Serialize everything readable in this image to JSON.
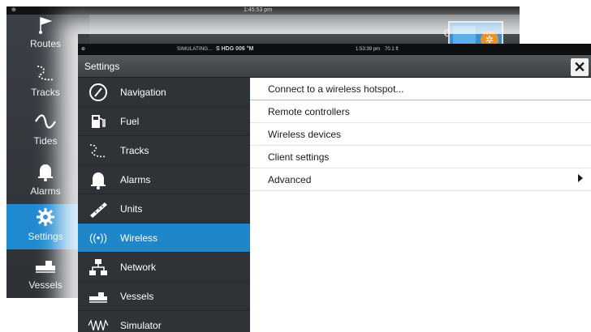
{
  "background_screen": {
    "status_time": "1:45:53 pm",
    "close_label": "Close",
    "sidebar": [
      {
        "label": "Routes",
        "icon": "route-flag-icon"
      },
      {
        "label": "Tracks",
        "icon": "track-icon"
      },
      {
        "label": "Tides",
        "icon": "wave-icon"
      },
      {
        "label": "Alarms",
        "icon": "bell-icon"
      },
      {
        "label": "Settings",
        "icon": "gear-icon",
        "selected": true
      },
      {
        "label": "Vessels",
        "icon": "vessel-icon"
      }
    ]
  },
  "dialog": {
    "status": {
      "simulating": "SIMULATING...",
      "heading": "S HDG 006 °M",
      "time": "1:53:39 pm",
      "depth": "70.1 ft"
    },
    "title": "Settings",
    "close_icon": "close-x-icon",
    "categories": [
      {
        "label": "Navigation",
        "icon": "compass-icon"
      },
      {
        "label": "Fuel",
        "icon": "fuel-pump-icon"
      },
      {
        "label": "Tracks",
        "icon": "track-icon"
      },
      {
        "label": "Alarms",
        "icon": "bell-icon"
      },
      {
        "label": "Units",
        "icon": "ruler-icon"
      },
      {
        "label": "Wireless",
        "icon": "wireless-icon",
        "selected": true
      },
      {
        "label": "Network",
        "icon": "network-icon"
      },
      {
        "label": "Vessels",
        "icon": "vessel-icon"
      },
      {
        "label": "Simulator",
        "icon": "simulator-wave-icon"
      }
    ],
    "options": [
      {
        "label": "Connect to a wireless hotspot...",
        "active": true
      },
      {
        "label": "Remote controllers"
      },
      {
        "label": "Wireless devices"
      },
      {
        "label": "Client settings"
      },
      {
        "label": "Advanced",
        "has_submenu": true
      }
    ]
  },
  "colors": {
    "accent": "#1f87c9",
    "panel_dark": "#2f3337",
    "titlebar": "#45494d"
  }
}
